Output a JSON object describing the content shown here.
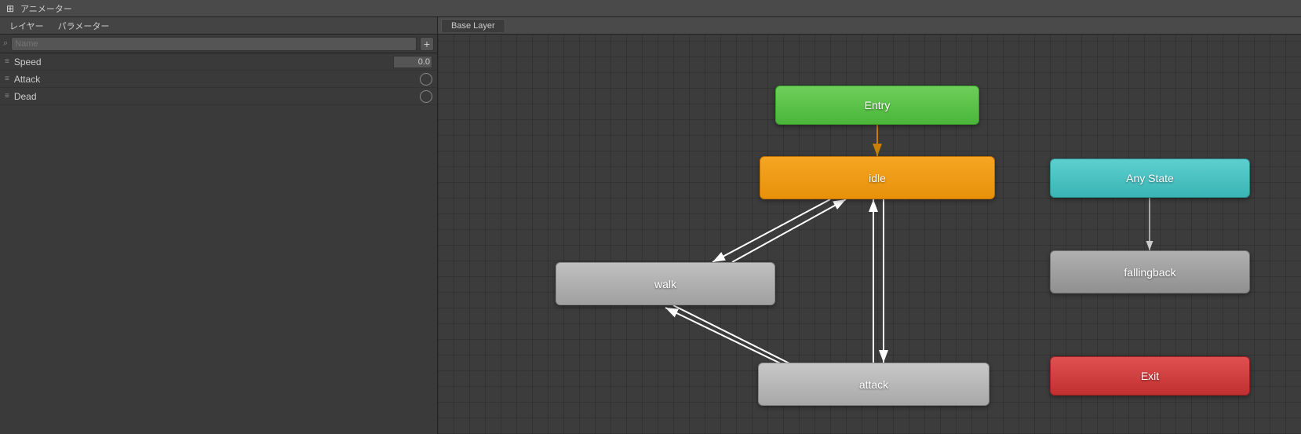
{
  "titlebar": {
    "icon": "⊞",
    "title": "アニメーター"
  },
  "tabs": {
    "layer": "レイヤー",
    "params": "パラメーター"
  },
  "search": {
    "placeholder": "Name",
    "add_button": "+"
  },
  "parameters": [
    {
      "name": "Speed",
      "type": "float",
      "value": "0.0"
    },
    {
      "name": "Attack",
      "type": "bool",
      "value": ""
    },
    {
      "name": "Dead",
      "type": "bool",
      "value": ""
    }
  ],
  "canvas": {
    "tab_label": "Base Layer"
  },
  "nodes": {
    "entry": {
      "label": "Entry"
    },
    "idle": {
      "label": "idle"
    },
    "walk": {
      "label": "walk"
    },
    "attack": {
      "label": "attack"
    },
    "any_state": {
      "label": "Any State"
    },
    "fallingback": {
      "label": "fallingback"
    },
    "exit": {
      "label": "Exit"
    }
  }
}
